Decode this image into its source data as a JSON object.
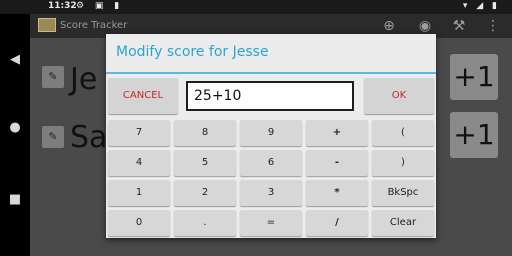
{
  "status_bar": {
    "time": "11:32",
    "left_icons": "⚙ ▣ ▮",
    "right_icons": "▾ ◢ ▮"
  },
  "app_bar": {
    "title": "Score Tracker",
    "actions": [
      "add-icon",
      "eye-icon",
      "wrench-icon",
      "overflow-menu-icon"
    ]
  },
  "players": [
    {
      "name": "Je",
      "increment_label": "+1"
    },
    {
      "name": "Sa",
      "increment_label": "+1"
    }
  ],
  "dialog": {
    "title": "Modify score for Jesse",
    "cancel_label": "CANCEL",
    "ok_label": "OK",
    "expression": "25+10",
    "keypad": [
      [
        "7",
        "8",
        "9",
        "+",
        "("
      ],
      [
        "4",
        "5",
        "6",
        "-",
        ")"
      ],
      [
        "1",
        "2",
        "3",
        "*",
        "BkSpc"
      ],
      [
        "0",
        ".",
        "=",
        "/",
        "Clear"
      ]
    ]
  },
  "colors": {
    "accent": "#2aa4cf",
    "cancel_text": "#c62828",
    "dialog_bg": "#ececec"
  }
}
